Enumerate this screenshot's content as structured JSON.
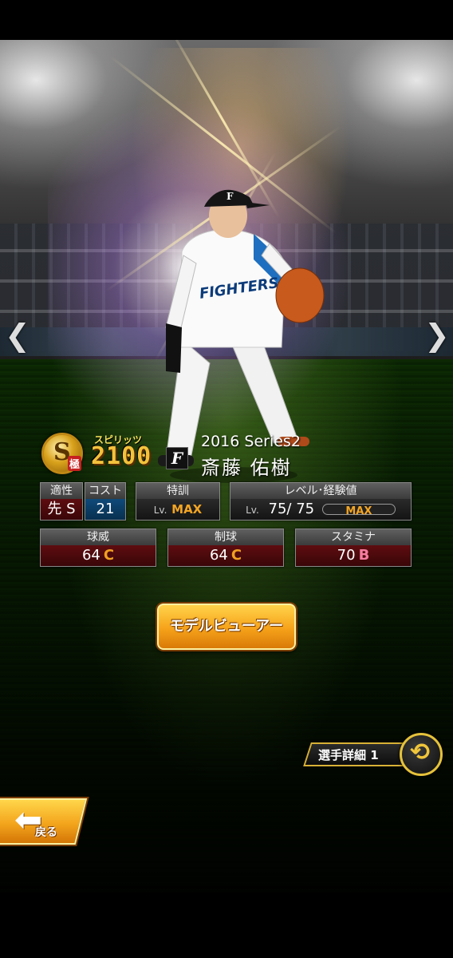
{
  "nav": {
    "prev_glyph": "❮",
    "next_glyph": "❯"
  },
  "card": {
    "spirit_grade": "S",
    "spirit_rank_kanji": "極",
    "spirit_label": "スピリッツ",
    "spirit_value": "2100",
    "team_logo_letter": "F",
    "series": "2016 Series2",
    "player_name": "斎藤 佑樹"
  },
  "stats": {
    "aptitude": {
      "label": "適性",
      "value": "先",
      "grade": "S"
    },
    "cost": {
      "label": "コスト",
      "value": "21"
    },
    "special_training": {
      "label": "特訓",
      "lv_prefix": "Lv.",
      "value": "MAX"
    },
    "level": {
      "label": "レベル･経験値",
      "lv_prefix": "Lv.",
      "value": "75/ 75",
      "bar_text": "MAX",
      "bar_fill": 1.0
    },
    "velocity": {
      "label": "球威",
      "value": "64",
      "grade": "C"
    },
    "control": {
      "label": "制球",
      "value": "64",
      "grade": "C"
    },
    "stamina": {
      "label": "スタミナ",
      "value": "70",
      "grade": "B"
    }
  },
  "buttons": {
    "model_viewer": "モデルビューアー",
    "player_detail": "選手詳細 1",
    "back": "戻る"
  },
  "colors": {
    "accent_gold": "#f3a524",
    "grade_c": "#f0a020",
    "grade_b": "#f57ca0",
    "stat_red": "#5e0d10",
    "cost_blue": "#0f4a7a"
  }
}
